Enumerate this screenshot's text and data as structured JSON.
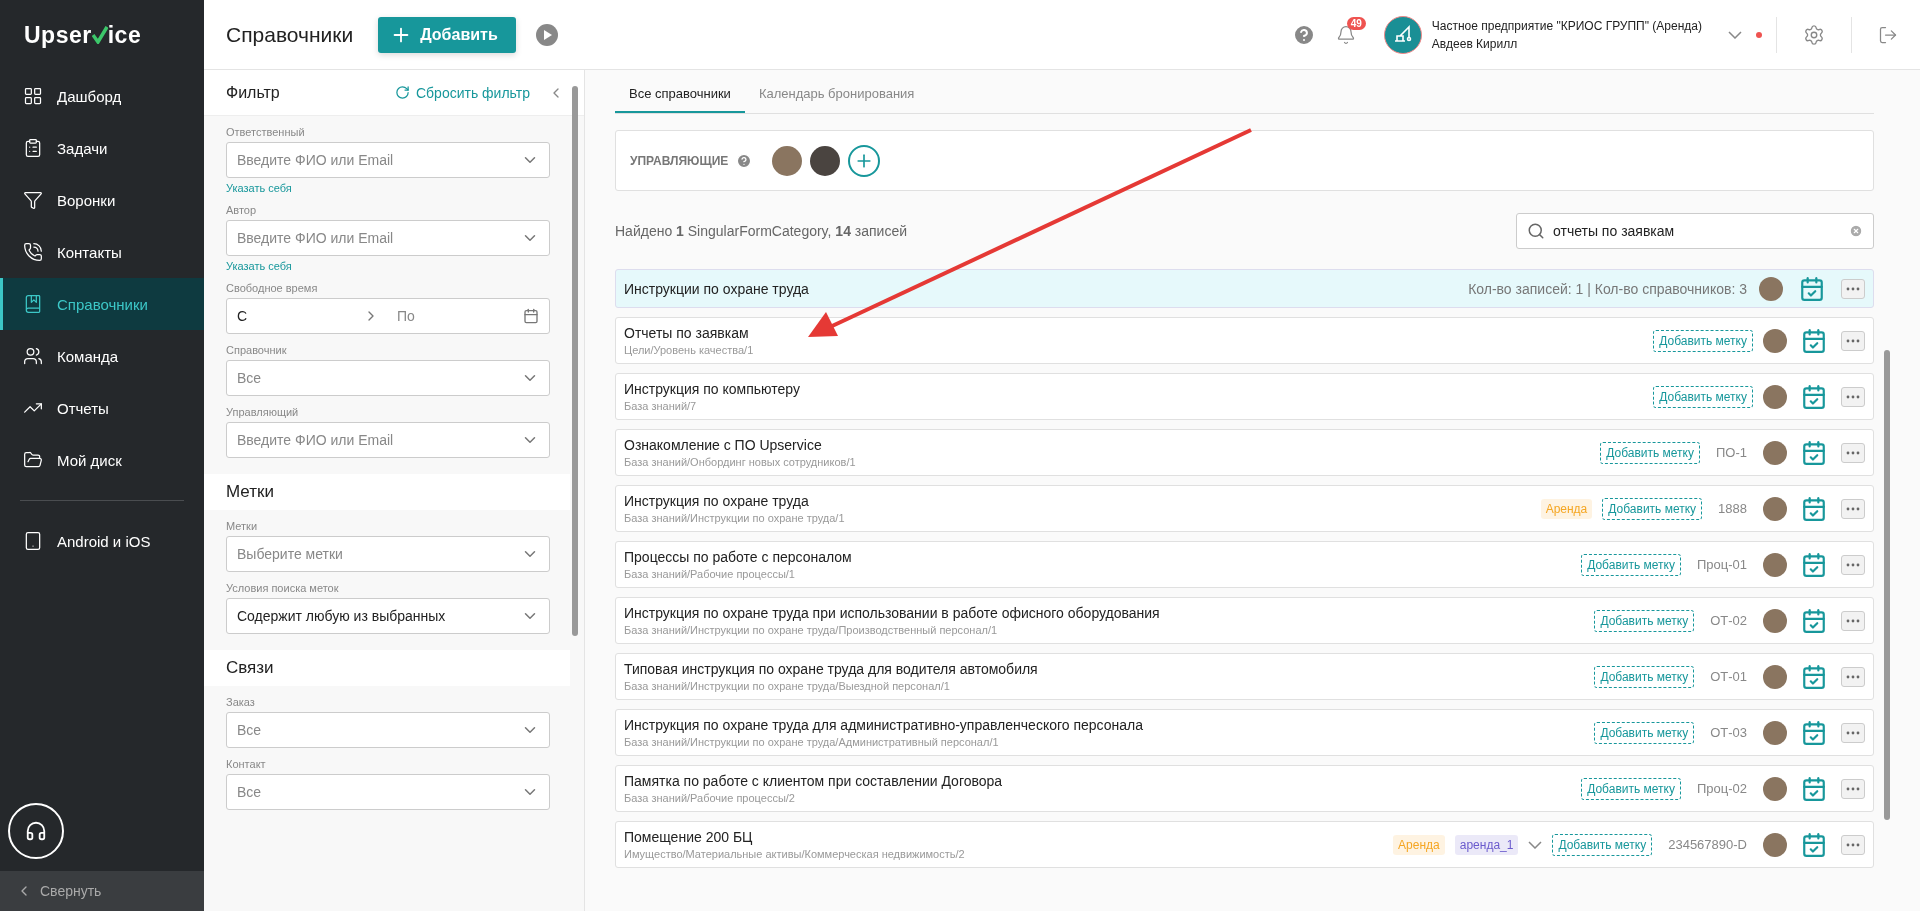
{
  "sidebar": {
    "logo": {
      "before": "Upser",
      "after": "ice"
    },
    "nav": [
      {
        "label": "Дашборд",
        "selected": false
      },
      {
        "label": "Задачи",
        "selected": false
      },
      {
        "label": "Воронки",
        "selected": false
      },
      {
        "label": "Контакты",
        "selected": false
      },
      {
        "label": "Справочники",
        "selected": true
      },
      {
        "label": "Команда",
        "selected": false
      },
      {
        "label": "Отчеты",
        "selected": false
      },
      {
        "label": "Мой диск",
        "selected": false
      }
    ],
    "nav_extra": [
      {
        "label": "Android и iOS",
        "selected": false
      }
    ],
    "collapse": "Свернуть"
  },
  "header": {
    "title": "Справочники",
    "add_button": "Добавить",
    "notifications": "49",
    "company": "Частное предприятие \"КРИОС ГРУПП\" (Аренда)",
    "user": "Авдеев Кирилл",
    "online": true
  },
  "filter": {
    "title": "Фильтр",
    "reset": "Сбросить фильтр",
    "sections": [
      {
        "fields": [
          {
            "kind": "select",
            "label": "Ответственный",
            "placeholder": "Введите ФИО или Email",
            "link": "Указать себя"
          },
          {
            "kind": "select",
            "label": "Автор",
            "placeholder": "Введите ФИО или Email",
            "link": "Указать себя"
          },
          {
            "kind": "range",
            "label": "Свободное время",
            "from": "С",
            "to": "По"
          },
          {
            "kind": "select",
            "label": "Справочник",
            "placeholder": "Все"
          },
          {
            "kind": "select",
            "label": "Управляющий",
            "placeholder": "Введите ФИО или Email"
          }
        ]
      },
      {
        "heading": "Метки",
        "fields": [
          {
            "kind": "select",
            "label": "Метки",
            "placeholder": "Выберите метки"
          },
          {
            "kind": "select",
            "label": "Условия поиска меток",
            "value": "Содержит любую из выбранных"
          }
        ]
      },
      {
        "heading": "Связи",
        "fields": [
          {
            "kind": "select",
            "label": "Заказ",
            "placeholder": "Все"
          },
          {
            "kind": "select",
            "label": "Контакт",
            "placeholder": "Все"
          }
        ]
      }
    ]
  },
  "tabs": [
    {
      "label": "Все справочники",
      "selected": true
    },
    {
      "label": "Календарь бронирования",
      "selected": false
    }
  ],
  "managers": {
    "label": "УПРАВЛЯЮЩИЕ"
  },
  "summary": "Найдено **1** SingularFormCategory, **14** записей",
  "search": {
    "value": "отчеты по заявкам"
  },
  "category": {
    "title": "Инструкции по охране труда",
    "stats": "Кол-во записей: 1 | Кол-во справочников: 3"
  },
  "items": [
    {
      "title": "Отчеты по заявкам",
      "path": "Цели/Уровень качества/1",
      "expandable": false,
      "add_tag": "Добавить метку"
    },
    {
      "title": "Инструкция по компьютеру",
      "path": "База знаний/7",
      "expandable": false,
      "add_tag": "Добавить метку"
    },
    {
      "title": "Ознакомление с ПО Upservice",
      "path": "База знаний/Онбординг новых сотрудников/1",
      "expandable": false,
      "add_tag": "Добавить метку",
      "code": "ПО-1"
    },
    {
      "title": "Инструкция по охране труда",
      "path": "База знаний/Инструкции по охране труда/1",
      "tags": [
        {
          "label": "Аренда",
          "color": "#f5a623"
        }
      ],
      "expandable": false,
      "add_tag": "Добавить метку",
      "code": "1888"
    },
    {
      "title": "Процессы по работе с персоналом",
      "path": "База знаний/Рабочие процессы/1",
      "expandable": false,
      "add_tag": "Добавить метку",
      "code": "Проц-01"
    },
    {
      "title": "Инструкция по охране труда при использовании в работе офисного оборудования",
      "path": "База знаний/Инструкции по охране труда/Производственный персонал/1",
      "expandable": false,
      "add_tag": "Добавить метку",
      "code": "ОТ-02"
    },
    {
      "title": "Типовая инструкция по охране труда для водителя автомобиля",
      "path": "База знаний/Инструкции по охране труда/Выездной персонал/1",
      "expandable": false,
      "add_tag": "Добавить метку",
      "code": "ОТ-01"
    },
    {
      "title": "Инструкция по охране труда для административно-управленческого персонала",
      "path": "База знаний/Инструкции по охране труда/Административный персонал/1",
      "expandable": false,
      "add_tag": "Добавить метку",
      "code": "ОТ-03"
    },
    {
      "title": "Памятка по работе с клиентом при составлении Договора",
      "path": "База знаний/Рабочие процессы/2",
      "expandable": false,
      "add_tag": "Добавить метку",
      "code": "Проц-02"
    },
    {
      "title": "Помещение 200 БЦ",
      "path": "Имущество/Материальные активы/Коммерческая недвижимость/2",
      "tags": [
        {
          "label": "Аренда",
          "color": "#f5a623"
        },
        {
          "label": "аренда_1",
          "color": "#6a5acd"
        }
      ],
      "expandable": true,
      "add_tag": "Добавить метку",
      "code": "234567890-D"
    }
  ]
}
